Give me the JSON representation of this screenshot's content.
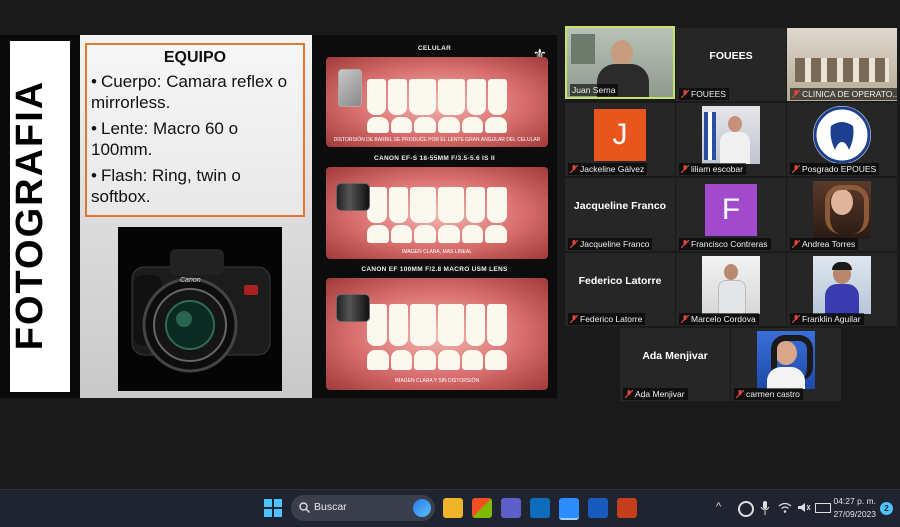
{
  "slide": {
    "vertical_title": "FOTOGRAFIA",
    "equipo_heading": "EQUIPO",
    "bullets": [
      "Cuerpo: Camara reflex o mirrorless.",
      "Lente: Macro 60 o 100mm.",
      "Flash: Ring, twin o softbox."
    ],
    "camera_brand": "Canon",
    "right": {
      "section1_title": "CELULAR",
      "section1_caption": "DISTORSIÓN DE BARRIL SE PRODUCE POR EL LENTE GRAN ANGULAR DEL CELULAR",
      "section2_title": "CANON EF-S 18-55MM F/3.5-5.6 IS II",
      "section2_caption": "IMAGEN CLARA, MAS LINEAL",
      "section3_title": "CANON EF 100MM F/2.8 MACRO USM LENS",
      "section3_caption": "IMAGEN CLARA Y SIN DISTORSIÓN"
    }
  },
  "participants": [
    {
      "name": "Juan Serna",
      "type": "video"
    },
    {
      "name": "FOUEES",
      "type": "text",
      "big": "FOUEES"
    },
    {
      "name": "CLINICA DE OPERATO...",
      "type": "video"
    },
    {
      "name": "Jackeline Gálvez",
      "type": "letter",
      "letter": "J",
      "color": "#e8561e"
    },
    {
      "name": "liliam escobar",
      "type": "video"
    },
    {
      "name": "Posgrado EPOUES",
      "type": "logo"
    },
    {
      "name": "Jacqueline Franco",
      "type": "text",
      "big": "Jacqueline Franco"
    },
    {
      "name": "Francisco Contreras",
      "type": "letter",
      "letter": "F",
      "color": "#a14bcc"
    },
    {
      "name": "Andrea Torres",
      "type": "video"
    },
    {
      "name": "Federico Latorre",
      "type": "text",
      "big": "Federico Latorre"
    },
    {
      "name": "Marcelo Cordova",
      "type": "video"
    },
    {
      "name": "Franklin Aguilar",
      "type": "video"
    },
    {
      "name": "Ada Menjivar",
      "type": "text",
      "big": "Ada Menjivar"
    },
    {
      "name": "carmen castro",
      "type": "video"
    }
  ],
  "taskbar": {
    "search_label": "Buscar",
    "time": "04:27 p. m.",
    "date": "27/09/2023",
    "notification_count": "2"
  },
  "colors": {
    "speaking_border": "#c7e36b",
    "muted_mic": "#e0463a",
    "taskbar_bg": "#1f2430"
  }
}
